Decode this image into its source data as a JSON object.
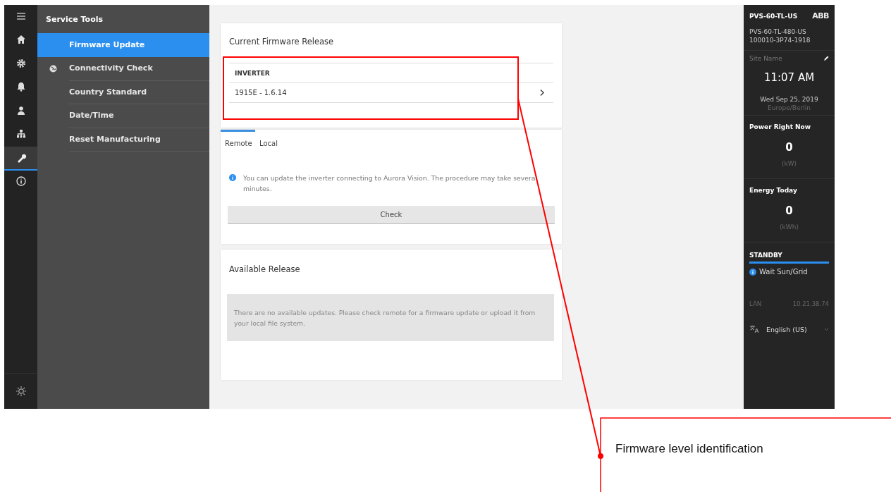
{
  "rail": {
    "items": [
      {
        "kind": "menu",
        "selected": false
      },
      {
        "kind": "home",
        "selected": false
      },
      {
        "kind": "gear",
        "selected": false
      },
      {
        "kind": "bell",
        "selected": false
      },
      {
        "kind": "user",
        "selected": false
      },
      {
        "kind": "network",
        "selected": false
      },
      {
        "kind": "wrench",
        "selected": true
      },
      {
        "kind": "info",
        "selected": false
      }
    ],
    "bottom": {
      "kind": "sun"
    }
  },
  "sidebar": {
    "title": "Service Tools",
    "items": [
      {
        "label": "Firmware Update",
        "selected": true,
        "kind": "plain"
      },
      {
        "label": "Connectivity Check",
        "selected": false,
        "kind": "globe"
      },
      {
        "label": "Country Standard",
        "selected": false,
        "kind": "plain"
      },
      {
        "label": "Date/Time",
        "selected": false,
        "kind": "plain"
      },
      {
        "label": "Reset Manufacturing",
        "selected": false,
        "kind": "plain"
      }
    ]
  },
  "current_release": {
    "title": "Current Firmware Release",
    "column": "INVERTER",
    "value": "1915E - 1.6.14"
  },
  "tabs": [
    {
      "label": "Remote",
      "selected": true
    },
    {
      "label": "Local",
      "selected": false
    }
  ],
  "info": "You can update the inverter connecting to Aurora Vision. The procedure may take several minutes.",
  "check_button": "Check",
  "available_release": {
    "title": "Available Release",
    "message": "There are no available updates. Please check remote for a firmware update or upload it from your local file system."
  },
  "device": {
    "model": "PVS-60-TL-US",
    "logo": "ABB",
    "model_full": "PVS-60-TL-480-US",
    "serial": "100010-3P74-1918",
    "site_name": {
      "placeholder": "Site Name"
    },
    "time": "11:07 AM",
    "date": "Wed Sep 25, 2019",
    "timezone": "Europe/Berlin"
  },
  "metrics": [
    {
      "label": "Power Right Now",
      "value": "0",
      "unit": "(kW)"
    },
    {
      "label": "Energy Today",
      "value": "0",
      "unit": "(kWh)"
    }
  ],
  "status": {
    "label": "STANDBY",
    "message": "Wait Sun/Grid"
  },
  "lan": {
    "label": "LAN",
    "value": "10.21.38.74"
  },
  "language": "English (US)",
  "annotation": {
    "text": "Firmware level identification"
  }
}
